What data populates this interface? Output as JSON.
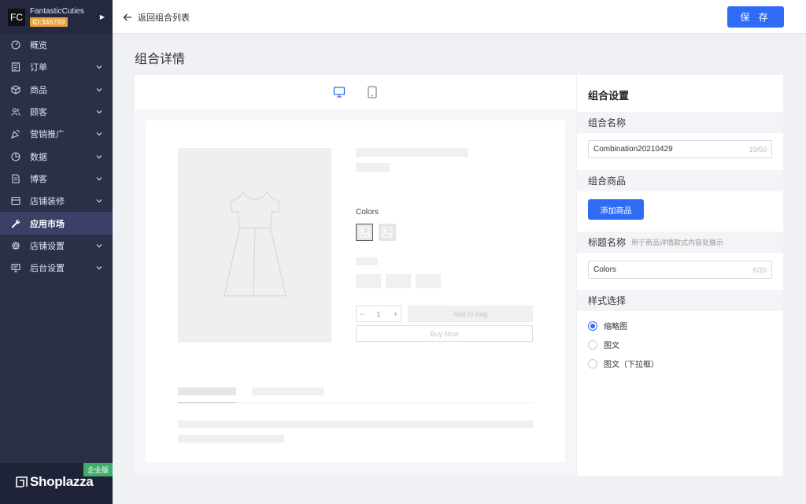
{
  "store": {
    "avatar": "FC",
    "name": "FantasticCuties",
    "id": "ID:346769"
  },
  "nav": [
    {
      "label": "概览",
      "icon": "dashboard-icon",
      "chevron": false,
      "active": false
    },
    {
      "label": "订单",
      "icon": "order-icon",
      "chevron": true,
      "active": false
    },
    {
      "label": "商品",
      "icon": "box-icon",
      "chevron": true,
      "active": false
    },
    {
      "label": "顾客",
      "icon": "users-icon",
      "chevron": true,
      "active": false
    },
    {
      "label": "营销推广",
      "icon": "megaphone-icon",
      "chevron": true,
      "active": false
    },
    {
      "label": "数据",
      "icon": "pie-chart-icon",
      "chevron": true,
      "active": false
    },
    {
      "label": "博客",
      "icon": "document-icon",
      "chevron": true,
      "active": false
    },
    {
      "label": "店铺装修",
      "icon": "layout-icon",
      "chevron": true,
      "active": false
    },
    {
      "label": "应用市场",
      "icon": "wrench-icon",
      "chevron": false,
      "active": true
    },
    {
      "label": "店铺设置",
      "icon": "gear-icon",
      "chevron": true,
      "active": false
    },
    {
      "label": "后台设置",
      "icon": "monitor-icon",
      "chevron": true,
      "active": false
    }
  ],
  "brand": {
    "badge": "企业版",
    "logo": "Shoplazza"
  },
  "header": {
    "back_label": "返回组合列表",
    "save_label": "保 存"
  },
  "page": {
    "title": "组合详情"
  },
  "preview": {
    "colors_label": "Colors",
    "qty_minus": "−",
    "qty_value": "1",
    "qty_plus": "+",
    "add_to_bag": "Add to bag",
    "buy_now": "Buy Now"
  },
  "settings": {
    "title": "组合设置",
    "name_section": "组合名称",
    "name_value": "Combination20210429",
    "name_counter": "19/50",
    "products_section": "组合商品",
    "add_product_label": "添加商品",
    "heading_section": "标题名称",
    "heading_hint": "用于商品详情款式内容处展示",
    "heading_value": "Colors",
    "heading_counter": "6/20",
    "style_section": "样式选择",
    "style_options": [
      "缩略图",
      "图文",
      "图文（下拉框）"
    ],
    "style_selected": 0
  },
  "colors": {
    "primary": "#2f6cf6",
    "sidebar": "#2b3049",
    "badge_orange": "#e8a23a",
    "badge_green": "#3fae6a"
  }
}
